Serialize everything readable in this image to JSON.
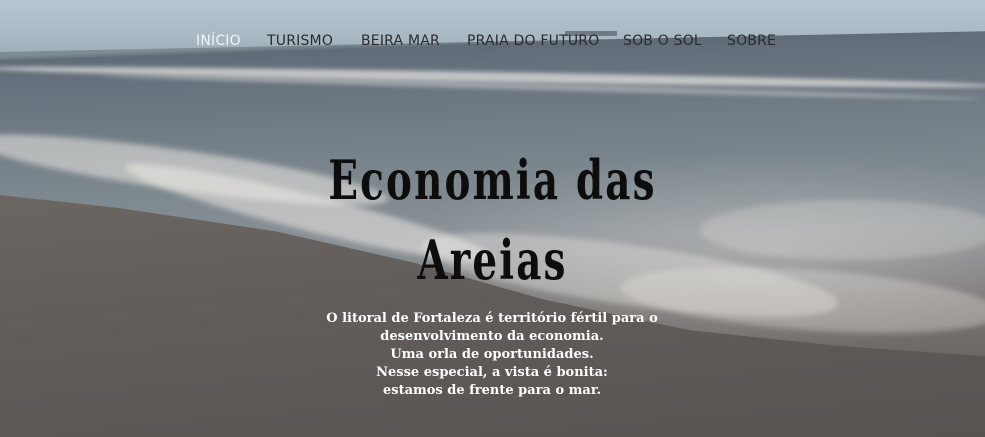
{
  "nav": {
    "items": [
      {
        "label": "INÍCIO",
        "active": true
      },
      {
        "label": "TURISMO",
        "active": false
      },
      {
        "label": "BEIRA MAR",
        "active": false
      },
      {
        "label": "PRAIA DO FUTURO",
        "active": false
      },
      {
        "label": "SOB O SOL",
        "active": false
      },
      {
        "label": "SOBRE",
        "active": false
      }
    ]
  },
  "hero": {
    "title_line1": "Economia das",
    "title_line2": "Areias",
    "intro_lines": [
      "O litoral de Fortaleza é território fértil para o",
      "desenvolvimento da economia.",
      "Uma orla de oportunidades.",
      "Nesse especial, a vista é bonita:",
      "estamos de frente para o mar."
    ]
  },
  "colors": {
    "nav_text": "#2b2b2b",
    "nav_active": "#f4f4f4",
    "title": "#0d0d0d",
    "intro": "#ffffff"
  }
}
